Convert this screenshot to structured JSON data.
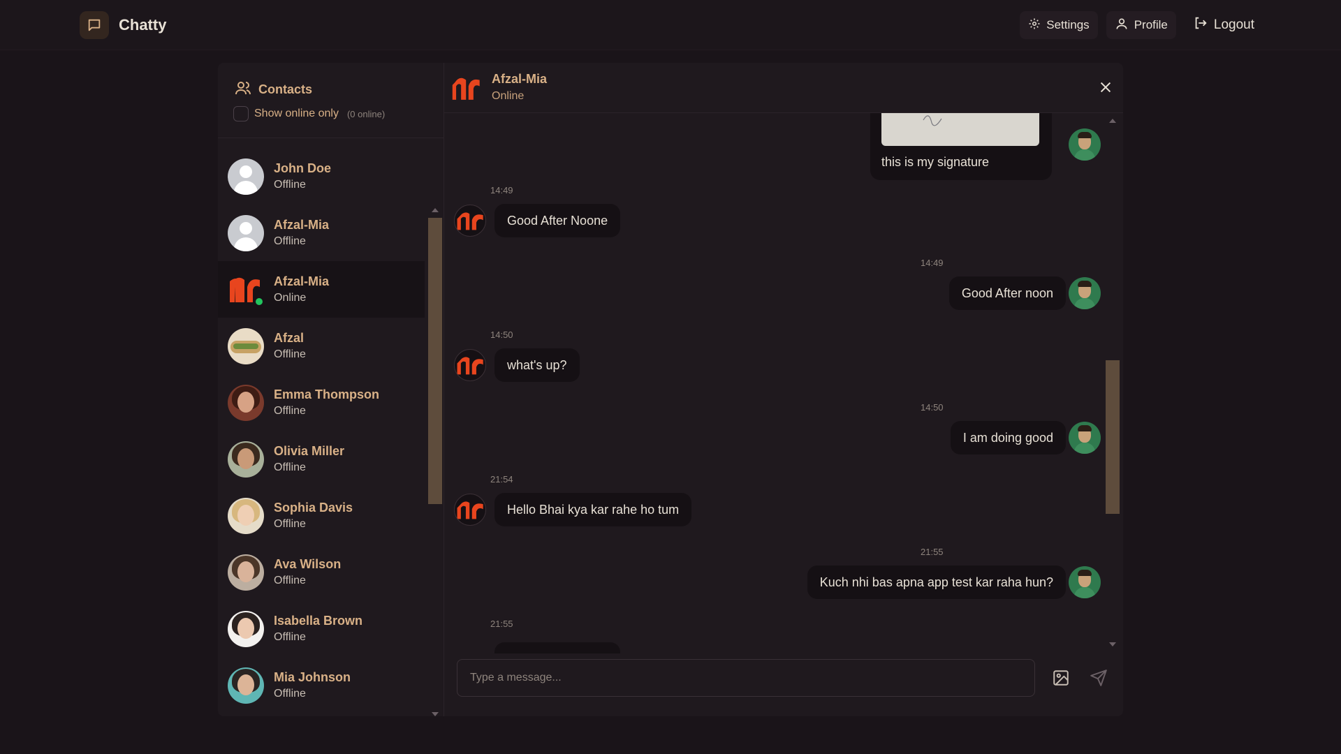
{
  "app": {
    "name": "Chatty"
  },
  "nav": {
    "settings": "Settings",
    "profile": "Profile",
    "logout": "Logout"
  },
  "sidebar": {
    "title": "Contacts",
    "filter_label": "Show online only",
    "online_count": "(0 online)",
    "contacts": [
      {
        "name": "John Doe",
        "status": "Offline",
        "avatar": "default"
      },
      {
        "name": "Afzal-Mia",
        "status": "Offline",
        "avatar": "default"
      },
      {
        "name": "Afzal-Mia",
        "status": "Online",
        "avatar": "nc-logo",
        "active": true,
        "online": true
      },
      {
        "name": "Afzal",
        "status": "Offline",
        "avatar": "food-photo"
      },
      {
        "name": "Emma Thompson",
        "status": "Offline",
        "avatar": "photo"
      },
      {
        "name": "Olivia Miller",
        "status": "Offline",
        "avatar": "photo"
      },
      {
        "name": "Sophia Davis",
        "status": "Offline",
        "avatar": "photo"
      },
      {
        "name": "Ava Wilson",
        "status": "Offline",
        "avatar": "photo"
      },
      {
        "name": "Isabella Brown",
        "status": "Offline",
        "avatar": "photo"
      },
      {
        "name": "Mia Johnson",
        "status": "Offline",
        "avatar": "photo"
      }
    ]
  },
  "chat": {
    "name": "Afzal-Mia",
    "status": "Online",
    "messages": [
      {
        "from": "me",
        "type": "image",
        "caption": "this is my signature"
      },
      {
        "from": "them",
        "time": "14:49",
        "text": "Good After Noone"
      },
      {
        "from": "me",
        "time": "14:49",
        "text": "Good After noon"
      },
      {
        "from": "them",
        "time": "14:50",
        "text": "what's up?"
      },
      {
        "from": "me",
        "time": "14:50",
        "text": "I am doing good"
      },
      {
        "from": "them",
        "time": "21:54",
        "text": "Hello Bhai kya kar rahe ho tum"
      },
      {
        "from": "me",
        "time": "21:55",
        "text": "Kuch nhi bas apna app test kar raha hun?"
      },
      {
        "from": "them",
        "time": "21:55",
        "text": ""
      }
    ],
    "input_placeholder": "Type a message..."
  },
  "colors": {
    "background": "#1a1419",
    "accent": "#d9b187",
    "bubble": "#151014",
    "online": "#22c55e",
    "logo_orange": "#e8451e"
  },
  "icons": {
    "brand": "message-square-icon",
    "settings": "gear-icon",
    "profile": "user-icon",
    "logout": "logout-icon",
    "contacts": "users-icon",
    "close": "close-icon",
    "image": "image-icon",
    "send": "send-icon"
  }
}
